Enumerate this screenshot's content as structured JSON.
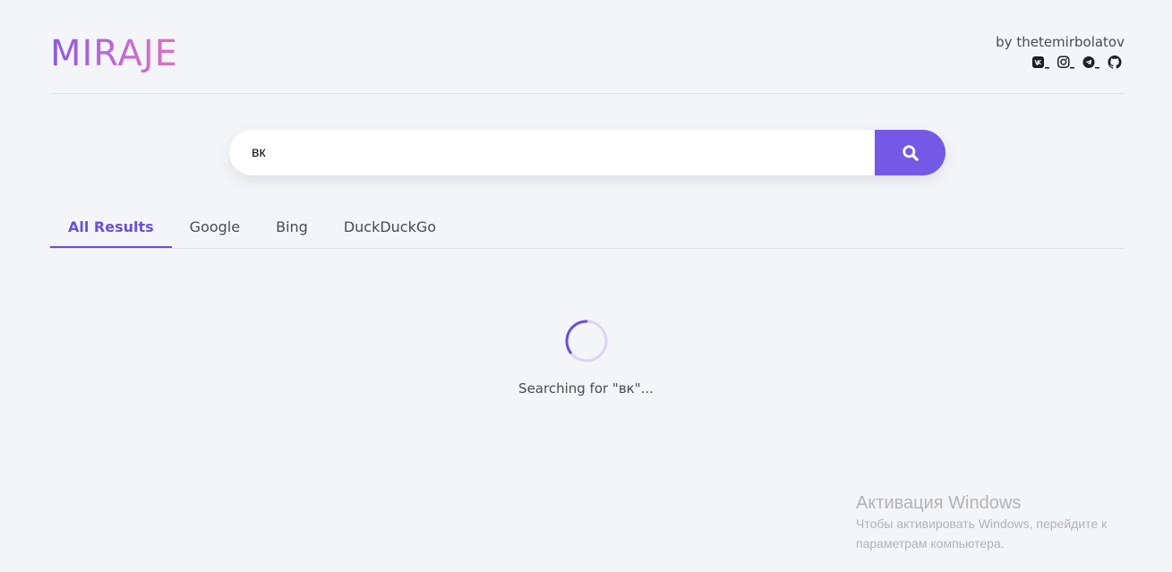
{
  "header": {
    "logo": "MIRAJE",
    "author": "by thetemirbolatov",
    "social": [
      {
        "icon": "vk-icon",
        "name": "VK"
      },
      {
        "icon": "instagram-icon",
        "name": "Instagram"
      },
      {
        "icon": "telegram-icon",
        "name": "Telegram"
      },
      {
        "icon": "github-icon",
        "name": "GitHub"
      }
    ]
  },
  "search": {
    "value": "вк",
    "button_icon": "search-icon"
  },
  "tabs": [
    {
      "label": "All Results",
      "active": true
    },
    {
      "label": "Google",
      "active": false
    },
    {
      "label": "Bing",
      "active": false
    },
    {
      "label": "DuckDuckGo",
      "active": false
    }
  ],
  "status": {
    "text": "Searching for \"вк\"..."
  },
  "watermark": {
    "title": "Активация Windows",
    "line1": "Чтобы активировать Windows, перейдите к",
    "line2": "параметрам компьютера."
  },
  "colors": {
    "accent": "#7459e7",
    "background": "#f4f5f9",
    "logo_gradient_start": "#8a5be0",
    "logo_gradient_end": "#e070b8"
  }
}
